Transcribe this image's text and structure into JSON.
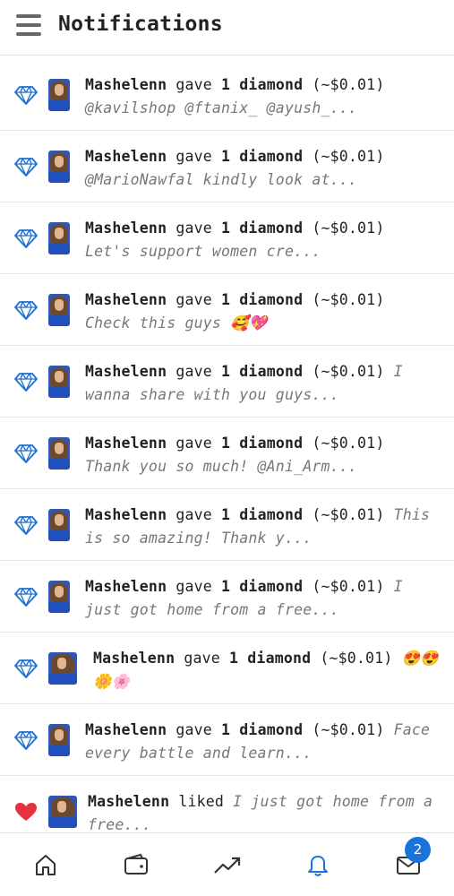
{
  "header": {
    "title": "Notifications",
    "menu_icon": "hamburger-menu-icon"
  },
  "colors": {
    "accent": "#1a73d9",
    "diamond": "#1e6fd0",
    "heart": "#e8313f",
    "snippet": "#777777"
  },
  "notifications": [
    {
      "type": "diamond",
      "icon": "diamond-icon",
      "user": "Mashelenn",
      "verb": " gave ",
      "amount": "1 diamond",
      "value": " (~$0.01) ",
      "snippet": "@kavilshop @ftanix_ @ayush_..."
    },
    {
      "type": "diamond",
      "icon": "diamond-icon",
      "user": "Mashelenn",
      "verb": " gave ",
      "amount": "1 diamond",
      "value": " (~$0.01) ",
      "snippet": "@MarioNawfal kindly look at..."
    },
    {
      "type": "diamond",
      "icon": "diamond-icon",
      "user": "Mashelenn",
      "verb": " gave ",
      "amount": "1 diamond",
      "value": " (~$0.01) ",
      "snippet": "Let's support women cre..."
    },
    {
      "type": "diamond",
      "icon": "diamond-icon",
      "user": "Mashelenn",
      "verb": " gave ",
      "amount": "1 diamond",
      "value": " (~$0.01) ",
      "snippet": "Check this guys 🥰💖"
    },
    {
      "type": "diamond",
      "icon": "diamond-icon",
      "user": "Mashelenn",
      "verb": " gave ",
      "amount": "1 diamond",
      "value": " (~$0.01) ",
      "snippet": "I wanna share with you guys..."
    },
    {
      "type": "diamond",
      "icon": "diamond-icon",
      "user": "Mashelenn",
      "verb": " gave ",
      "amount": "1 diamond",
      "value": " (~$0.01) ",
      "snippet": "Thank you so much! @Ani_Arm..."
    },
    {
      "type": "diamond",
      "icon": "diamond-icon",
      "user": "Mashelenn",
      "verb": " gave ",
      "amount": "1 diamond",
      "value": " (~$0.01) ",
      "snippet": "This is so amazing! Thank y..."
    },
    {
      "type": "diamond",
      "icon": "diamond-icon",
      "user": "Mashelenn",
      "verb": " gave ",
      "amount": "1 diamond",
      "value": " (~$0.01) ",
      "snippet": "I just got home from a free..."
    },
    {
      "type": "diamond",
      "icon": "diamond-icon",
      "user": "Mashelenn",
      "verb": " gave ",
      "amount": "1 diamond",
      "value": " (~$0.01) ",
      "snippet": "😍😍🌼🌸"
    },
    {
      "type": "diamond",
      "icon": "diamond-icon",
      "user": "Mashelenn",
      "verb": " gave ",
      "amount": "1 diamond",
      "value": " (~$0.01) ",
      "snippet": "Face every battle and learn..."
    },
    {
      "type": "like",
      "icon": "heart-icon",
      "user": "Mashelenn",
      "verb": " liked ",
      "amount": "",
      "value": "",
      "snippet": "I just got home from a free..."
    }
  ],
  "bottom_nav": {
    "items": [
      {
        "name": "home",
        "icon": "home-icon"
      },
      {
        "name": "wallet",
        "icon": "wallet-icon"
      },
      {
        "name": "trending",
        "icon": "trending-icon"
      },
      {
        "name": "notifications",
        "icon": "bell-icon",
        "active": true
      },
      {
        "name": "messages",
        "icon": "mail-icon"
      }
    ],
    "messages_badge": "2"
  }
}
